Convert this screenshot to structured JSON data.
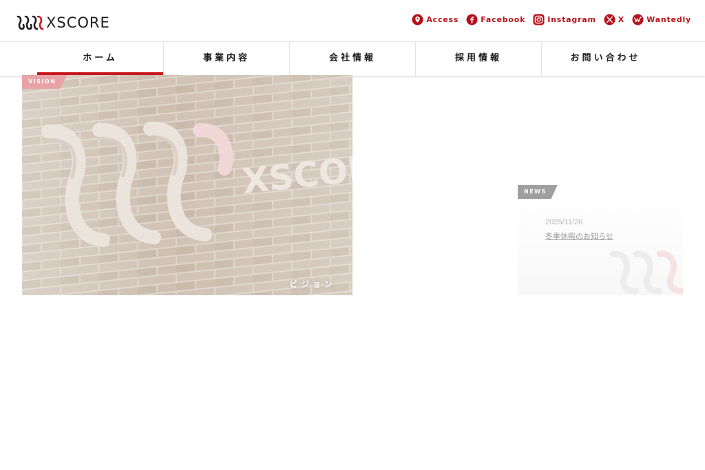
{
  "header": {
    "logo_text": "XSCORE",
    "links": [
      {
        "label": "Access",
        "icon": "map-pin-icon"
      },
      {
        "label": "Facebook",
        "icon": "facebook-icon"
      },
      {
        "label": "Instagram",
        "icon": "instagram-icon"
      },
      {
        "label": "X",
        "icon": "x-icon"
      },
      {
        "label": "Wantedly",
        "icon": "wantedly-icon"
      }
    ]
  },
  "nav": {
    "items": [
      {
        "label": "ホーム",
        "active": true
      },
      {
        "label": "事業内容",
        "active": false
      },
      {
        "label": "会社情報",
        "active": false
      },
      {
        "label": "採用情報",
        "active": false
      },
      {
        "label": "お問い合わせ",
        "active": false
      }
    ]
  },
  "vision": {
    "tag": "VISION",
    "caption": "ビジョン",
    "sign_text": "XSCORE"
  },
  "news": {
    "tag": "NEWS",
    "items": [
      {
        "date": "2025/11/26",
        "title": "冬季休暇のお知らせ"
      }
    ]
  },
  "colors": {
    "brand_red": "#c8161d",
    "link_red": "#b5121b",
    "vision_tag": "#e8a3a6",
    "news_tag": "#9f9f9f",
    "text_dark": "#1a1a1a"
  }
}
